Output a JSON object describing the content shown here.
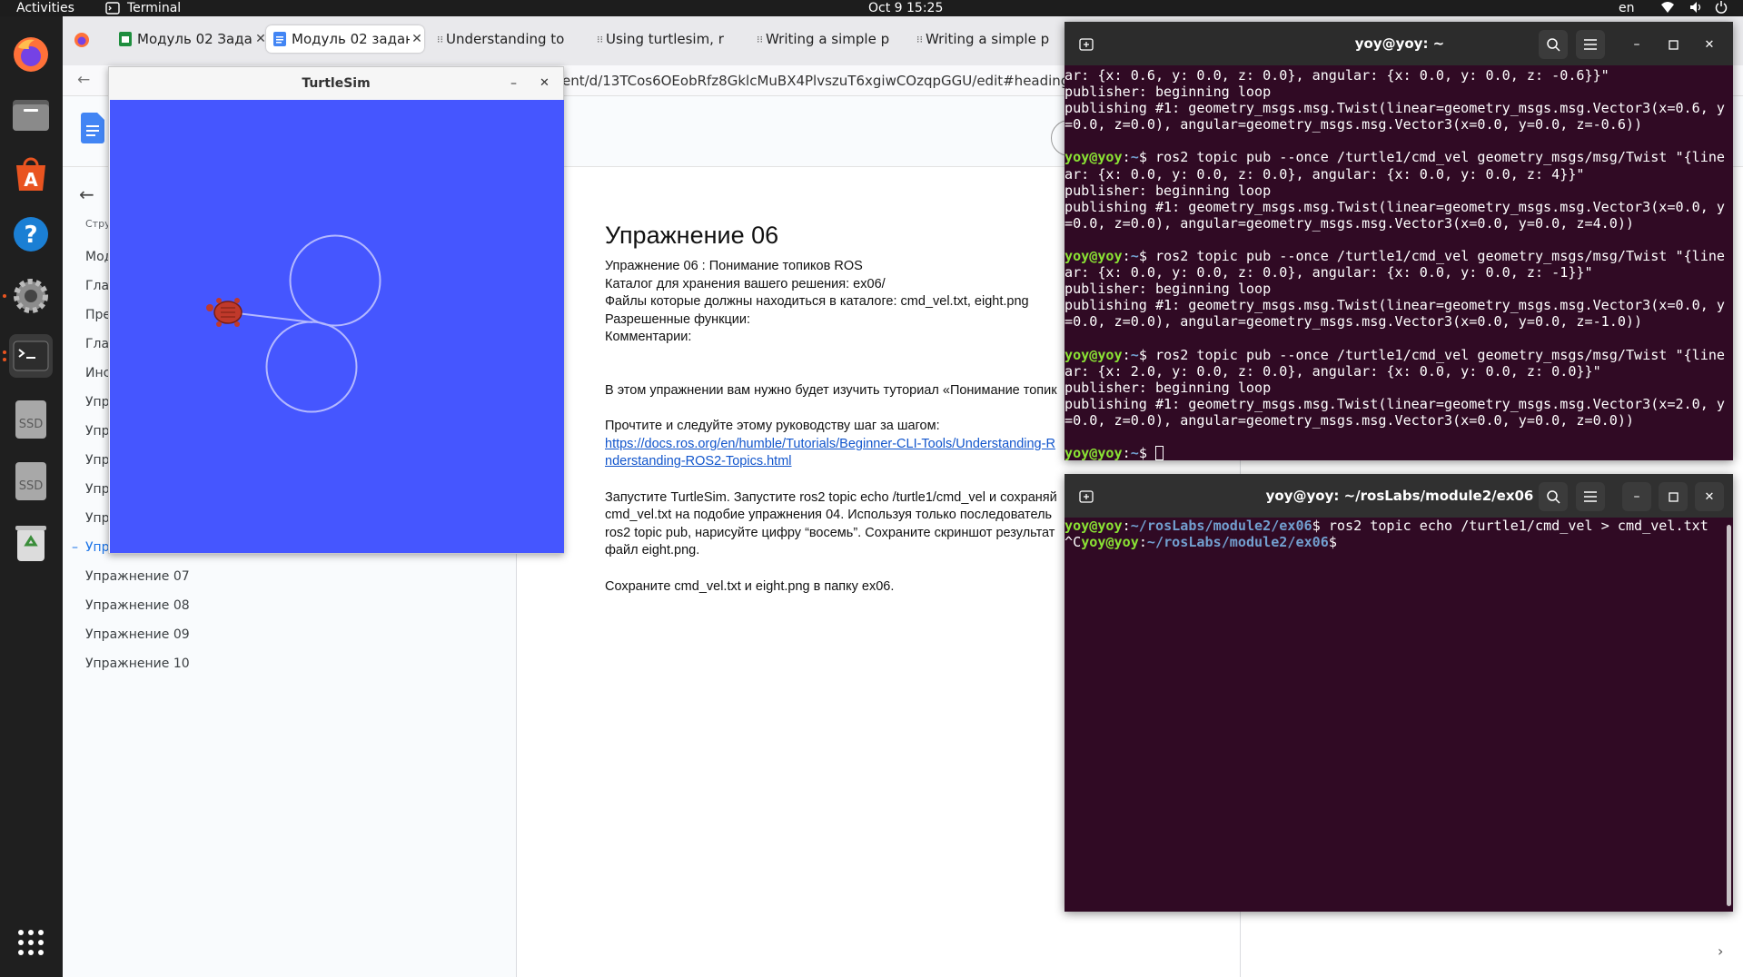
{
  "topbar": {
    "activities": "Activities",
    "app_name": "Terminal",
    "datetime": "Oct 9  15:25",
    "lang": "en"
  },
  "dock": {
    "items": [
      "firefox-icon",
      "files-icon",
      "app-center-icon",
      "help-icon",
      "settings-icon",
      "terminal-icon",
      "ssd-drive-icon",
      "ssd-drive-icon",
      "trash-icon",
      "show-apps-icon"
    ],
    "ssd_label": "SSD"
  },
  "browser": {
    "tabs": [
      {
        "label": "Модуль 02 Задан",
        "icon": "sheets-icon",
        "active": false
      },
      {
        "label": "Модуль 02 задан",
        "icon": "docs-icon",
        "active": true
      },
      {
        "label": "Understanding to",
        "icon": "ros-icon",
        "active": false
      },
      {
        "label": "Using turtlesim, r",
        "icon": "ros-icon",
        "active": false
      },
      {
        "label": "Writing a simple p",
        "icon": "ros-icon",
        "active": false
      },
      {
        "label": "Writing a simple p",
        "icon": "ros-icon",
        "active": false
      }
    ],
    "url": "ent/d/13TCos6OEobRfz8GklcMuBX4PlvszuT6xgiwCOzqpGGU/edit#heading=h.n",
    "outline_header": "Стру",
    "outline_items_truncated": [
      "Мод",
      "Глав",
      "Пре",
      "Глав",
      "Инс",
      "Упр",
      "Упр",
      "Упр",
      "Упр",
      "Упр",
      "Упр"
    ],
    "outline_items": [
      "Упражнение 07",
      "Упражнение 08",
      "Упражнение 09",
      "Упражнение 10"
    ],
    "doc": {
      "heading": "Упражнение 06",
      "meta": [
        "Упражнение 06 : Понимание топиков ROS",
        "Каталог для хранения вашего решения: ex06/",
        "Файлы которые должны находиться в каталоге: cmd_vel.txt, eight.png",
        "Разрешенные функции:",
        "Комментарии:"
      ],
      "intro": "В этом упражнении вам нужно будет изучить туториал «Понимание топик",
      "follow": "Прочтите и следуйте этому руководству шаг за шагом:",
      "link_line1": "https://docs.ros.org/en/humble/Tutorials/Beginner-CLI-Tools/Understanding-R",
      "link_line2": "nderstanding-ROS2-Topics.html",
      "task": [
        "Запустите TurtleSim. Запустите ros2 topic echo /turtle1/cmd_vel и сохраняй",
        "cmd_vel.txt на подобие упражнения 04. Используя только последователь",
        "ros2 topic pub, нарисуйте цифру “восемь”. Сохраните скриншот результат",
        "файл eight.png."
      ],
      "save": "Сохраните cmd_vel.txt и eight.png в папку ex06."
    }
  },
  "turtlesim": {
    "title": "TurtleSim",
    "bg_color": "#4556ff",
    "pen_color": "#b3b8ff"
  },
  "terminal1": {
    "title": "yoy@yoy: ~",
    "lines": [
      [
        [
          "",
          "ar: {x: 0.6, y: 0.0, z: 0.0}, angular: {x: 0.0, y: 0.0, z: -0.6}}\""
        ]
      ],
      [
        [
          "",
          "publisher: beginning loop"
        ]
      ],
      [
        [
          "",
          "publishing #1: geometry_msgs.msg.Twist(linear=geometry_msgs.msg.Vector3(x=0.6, y"
        ]
      ],
      [
        [
          "",
          "=0.0, z=0.0), angular=geometry_msgs.msg.Vector3(x=0.0, y=0.0, z=-0.6))"
        ]
      ],
      [
        [
          "",
          ""
        ]
      ],
      [
        [
          "pu",
          "yoy@yoy"
        ],
        [
          "",
          ":"
        ],
        [
          "pp",
          "~"
        ],
        [
          "",
          "$ ros2 topic pub --once /turtle1/cmd_vel geometry_msgs/msg/Twist \"{line"
        ]
      ],
      [
        [
          "",
          "ar: {x: 0.0, y: 0.0, z: 0.0}, angular: {x: 0.0, y: 0.0, z: 4}}\""
        ]
      ],
      [
        [
          "",
          "publisher: beginning loop"
        ]
      ],
      [
        [
          "",
          "publishing #1: geometry_msgs.msg.Twist(linear=geometry_msgs.msg.Vector3(x=0.0, y"
        ]
      ],
      [
        [
          "",
          "=0.0, z=0.0), angular=geometry_msgs.msg.Vector3(x=0.0, y=0.0, z=4.0))"
        ]
      ],
      [
        [
          "",
          ""
        ]
      ],
      [
        [
          "pu",
          "yoy@yoy"
        ],
        [
          "",
          ":"
        ],
        [
          "pp",
          "~"
        ],
        [
          "",
          "$ ros2 topic pub --once /turtle1/cmd_vel geometry_msgs/msg/Twist \"{line"
        ]
      ],
      [
        [
          "",
          "ar: {x: 0.0, y: 0.0, z: 0.0}, angular: {x: 0.0, y: 0.0, z: -1}}\""
        ]
      ],
      [
        [
          "",
          "publisher: beginning loop"
        ]
      ],
      [
        [
          "",
          "publishing #1: geometry_msgs.msg.Twist(linear=geometry_msgs.msg.Vector3(x=0.0, y"
        ]
      ],
      [
        [
          "",
          "=0.0, z=0.0), angular=geometry_msgs.msg.Vector3(x=0.0, y=0.0, z=-1.0))"
        ]
      ],
      [
        [
          "",
          ""
        ]
      ],
      [
        [
          "pu",
          "yoy@yoy"
        ],
        [
          "",
          ":"
        ],
        [
          "pp",
          "~"
        ],
        [
          "",
          "$ ros2 topic pub --once /turtle1/cmd_vel geometry_msgs/msg/Twist \"{line"
        ]
      ],
      [
        [
          "",
          "ar: {x: 2.0, y: 0.0, z: 0.0}, angular: {x: 0.0, y: 0.0, z: 0.0}}\""
        ]
      ],
      [
        [
          "",
          "publisher: beginning loop"
        ]
      ],
      [
        [
          "",
          "publishing #1: geometry_msgs.msg.Twist(linear=geometry_msgs.msg.Vector3(x=2.0, y"
        ]
      ],
      [
        [
          "",
          "=0.0, z=0.0), angular=geometry_msgs.msg.Vector3(x=0.0, y=0.0, z=0.0))"
        ]
      ],
      [
        [
          "",
          ""
        ]
      ],
      [
        [
          "pu",
          "yoy@yoy"
        ],
        [
          "",
          ":"
        ],
        [
          "pp",
          "~"
        ],
        [
          "",
          "$ "
        ],
        [
          "cursor",
          ""
        ]
      ]
    ]
  },
  "terminal2": {
    "title": "yoy@yoy: ~/rosLabs/module2/ex06",
    "lines": [
      [
        [
          "pu",
          "yoy@yoy"
        ],
        [
          "",
          ":"
        ],
        [
          "pp",
          "~/rosLabs/module2/ex06"
        ],
        [
          "",
          "$ ros2 topic echo /turtle1/cmd_vel > cmd_vel.txt"
        ]
      ],
      [
        [
          "",
          "^C"
        ],
        [
          "pu",
          "yoy@yoy"
        ],
        [
          "",
          ":"
        ],
        [
          "pp",
          "~/rosLabs/module2/ex06"
        ],
        [
          "",
          "$"
        ]
      ]
    ]
  },
  "colors": {
    "terminal_bg": "#300a24",
    "prompt_user": "#8ae234",
    "prompt_path": "#729fcf",
    "link": "#1155cc"
  }
}
